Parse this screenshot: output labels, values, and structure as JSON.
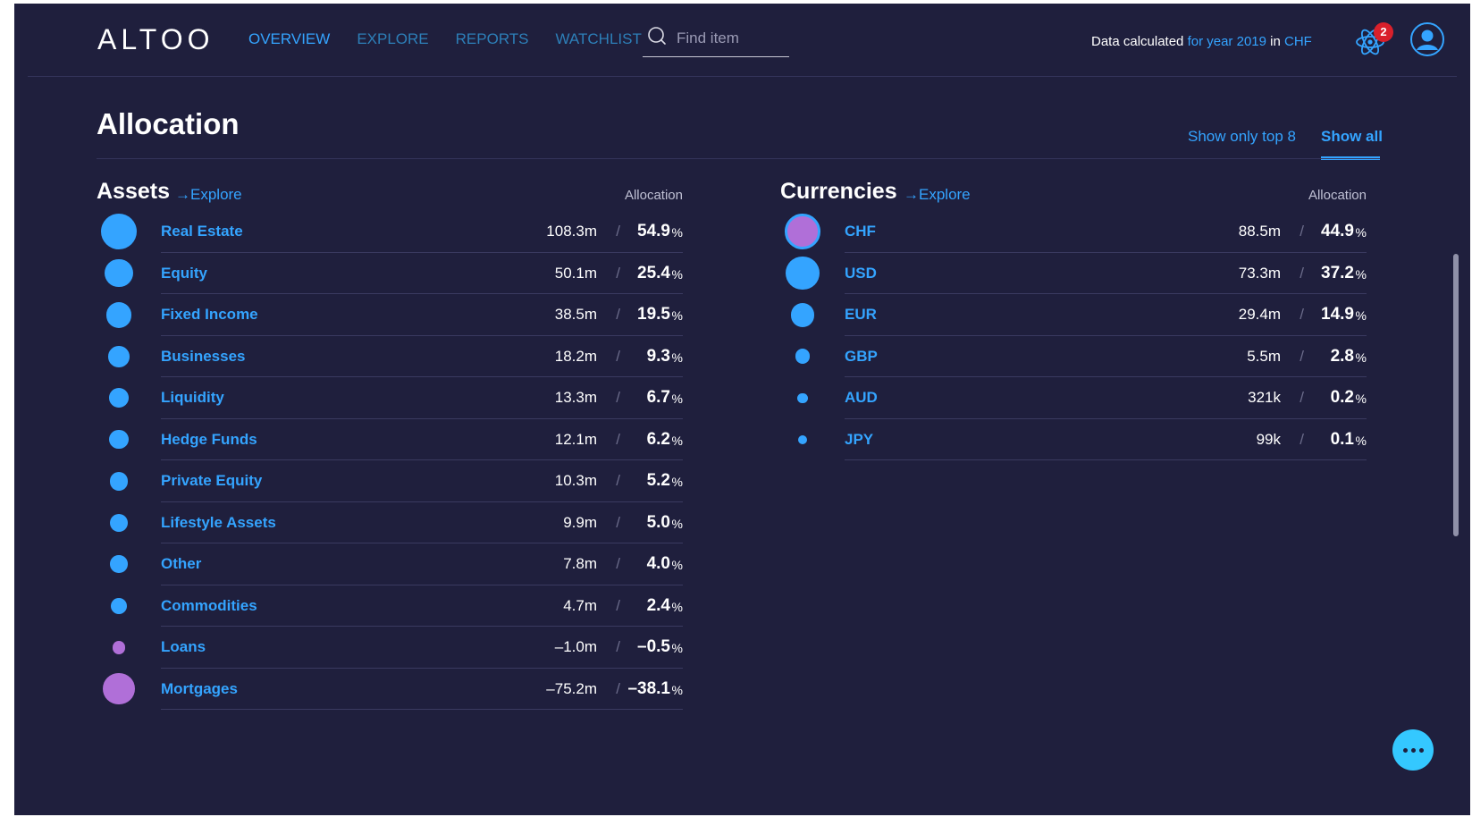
{
  "header": {
    "logo": "ALTOO",
    "nav": [
      {
        "label": "OVERVIEW",
        "active": true
      },
      {
        "label": "EXPLORE",
        "active": false
      },
      {
        "label": "REPORTS",
        "active": false
      },
      {
        "label": "WATCHLIST",
        "active": false
      }
    ],
    "search_placeholder": "Find item",
    "calc_prefix": "Data calculated",
    "calc_year": "for year 2019",
    "calc_in": "in",
    "calc_currency": "CHF",
    "notification_count": "2",
    "icons": {
      "search": "search-icon",
      "notifications": "atom-icon",
      "profile": "user-icon"
    }
  },
  "allocation": {
    "title": "Allocation",
    "toggle_top": "Show only top 8",
    "toggle_all": "Show all",
    "active_toggle": "Show all"
  },
  "assets": {
    "title": "Assets",
    "explore": "Explore",
    "column": "Allocation",
    "rows": [
      {
        "name": "Real Estate",
        "amount": "108.3m",
        "pct": "54.9",
        "negative": false
      },
      {
        "name": "Equity",
        "amount": "50.1m",
        "pct": "25.4",
        "negative": false
      },
      {
        "name": "Fixed Income",
        "amount": "38.5m",
        "pct": "19.5",
        "negative": false
      },
      {
        "name": "Businesses",
        "amount": "18.2m",
        "pct": "9.3",
        "negative": false
      },
      {
        "name": "Liquidity",
        "amount": "13.3m",
        "pct": "6.7",
        "negative": false
      },
      {
        "name": "Hedge Funds",
        "amount": "12.1m",
        "pct": "6.2",
        "negative": false
      },
      {
        "name": "Private Equity",
        "amount": "10.3m",
        "pct": "5.2",
        "negative": false
      },
      {
        "name": "Lifestyle Assets",
        "amount": "9.9m",
        "pct": "5.0",
        "negative": false
      },
      {
        "name": "Other",
        "amount": "7.8m",
        "pct": "4.0",
        "negative": false
      },
      {
        "name": "Commodities",
        "amount": "4.7m",
        "pct": "2.4",
        "negative": false
      },
      {
        "name": "Loans",
        "amount": "–1.0m",
        "pct": "–0.5",
        "negative": true
      },
      {
        "name": "Mortgages",
        "amount": "–75.2m",
        "pct": "–38.1",
        "negative": true
      }
    ]
  },
  "currencies": {
    "title": "Currencies",
    "explore": "Explore",
    "column": "Allocation",
    "rows": [
      {
        "name": "CHF",
        "amount": "88.5m",
        "pct": "44.9",
        "negative": false,
        "highlight": true
      },
      {
        "name": "USD",
        "amount": "73.3m",
        "pct": "37.2",
        "negative": false
      },
      {
        "name": "EUR",
        "amount": "29.4m",
        "pct": "14.9",
        "negative": false
      },
      {
        "name": "GBP",
        "amount": "5.5m",
        "pct": "2.8",
        "negative": false
      },
      {
        "name": "AUD",
        "amount": "321k",
        "pct": "0.2",
        "negative": false
      },
      {
        "name": "JPY",
        "amount": "99k",
        "pct": "0.1",
        "negative": false
      }
    ]
  },
  "labels": {
    "slash": "/",
    "percent": "%",
    "arrow": "→"
  },
  "colors": {
    "background": "#1f1f3d",
    "accent": "#34a4ff",
    "negative": "#b06fd8",
    "badge": "#d9202b",
    "chat": "#34c8ff"
  }
}
